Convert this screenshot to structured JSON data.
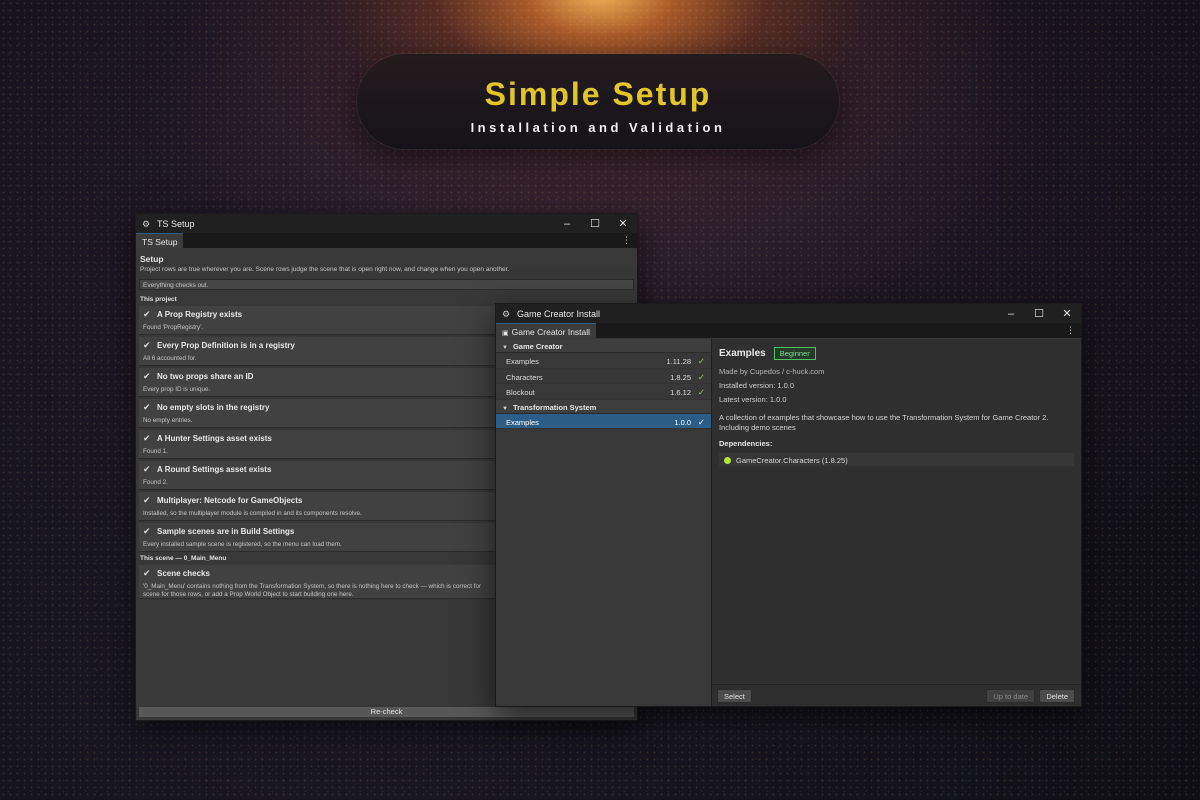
{
  "banner": {
    "title": "Simple Setup",
    "subtitle": "Installation and Validation"
  },
  "ts_window": {
    "title": "TS Setup",
    "tab": "TS Setup",
    "heading": "Setup",
    "description": "Project rows are true wherever you are. Scene rows judge the scene that is open right now, and change when you open another.",
    "status": "Everything checks out.",
    "project_section": "This project",
    "rows": [
      {
        "title": "A Prop Registry exists",
        "detail": "Found 'PropRegistry'."
      },
      {
        "title": "Every Prop Definition is in a registry",
        "detail": "All 6 accounted for."
      },
      {
        "title": "No two props share an ID",
        "detail": "Every prop ID is unique."
      },
      {
        "title": "No empty slots in the registry",
        "detail": "No empty entries."
      },
      {
        "title": "A Hunter Settings asset exists",
        "detail": "Found 1."
      },
      {
        "title": "A Round Settings asset exists",
        "detail": "Found 2."
      },
      {
        "title": "Multiplayer: Netcode for GameObjects",
        "detail": "Installed, so the multiplayer module is compiled in and its components resolve."
      },
      {
        "title": "Sample scenes are in Build Settings",
        "detail": "Every installed sample scene is registered, so the menu can load them."
      }
    ],
    "scene_section": "This scene — 0_Main_Menu",
    "scene_row": {
      "title": "Scene checks",
      "detail_line1": "'0_Main_Menu' contains nothing from the Transformation System, so there is nothing here to check — which is correct for",
      "detail_line2": "scene for those rows, or add a Prop World Object to start building one here."
    },
    "recheck_label": "Re-check",
    "check_glyph": "✔"
  },
  "gc_window": {
    "title": "Game Creator Install",
    "tab": "Game Creator Install",
    "groups": [
      {
        "name": "Game Creator",
        "items": [
          {
            "name": "Examples",
            "version": "1.11.28"
          },
          {
            "name": "Characters",
            "version": "1.8.25"
          },
          {
            "name": "Blockout",
            "version": "1.6.12"
          }
        ]
      },
      {
        "name": "Transformation System",
        "items": [
          {
            "name": "Examples",
            "version": "1.0.0"
          }
        ]
      }
    ],
    "detail": {
      "title": "Examples",
      "badge": "Beginner",
      "author": "Made by Cupedos / c-huck.com",
      "installed": "Installed version: 1.0.0",
      "latest": "Latest version: 1.0.0",
      "description": "A collection of examples that showcase how to use the Transformation System for Game Creator 2. Including demo scenes",
      "dependencies_label": "Dependencies:",
      "dependency": "GameCreator.Characters (1.8.25)"
    },
    "buttons": {
      "select": "Select",
      "up_to_date": "Up to date",
      "delete": "Delete"
    }
  },
  "colors": {
    "accent": "#e2c529",
    "selection": "#2c5d87",
    "ok": "#8fd34a",
    "badge": "#4fbf63"
  },
  "icons": {
    "window": "gear-icon",
    "check": "checkmark-icon",
    "expand": "triangle-down-icon",
    "menu": "kebab-icon"
  }
}
